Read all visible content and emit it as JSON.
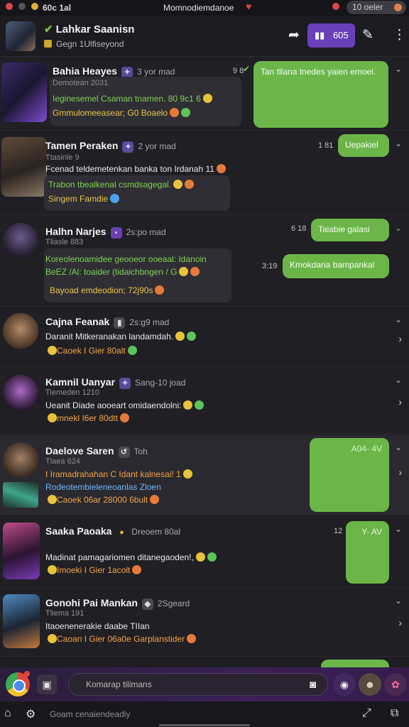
{
  "status": {
    "left_text": "60c 1al",
    "center_text": "Momnodiemdanoe",
    "pill_text": "10 oeler"
  },
  "header": {
    "title": "Lahkar Saanisn",
    "subtitle": "Gegn 1Ulfiseyond",
    "pill_label": "605",
    "colors": {
      "accent": "#6a40b8",
      "bubble_out": "#6bb549"
    }
  },
  "chats": [
    {
      "name": "Bahia Heayes",
      "meta": "3 yor mad",
      "sub": "Demotean 2031",
      "lines": [
        "Ieginesemel Csaman tnamen. 80 9c1 6",
        "Gmmulomeeasear;  G0 Boaelo"
      ],
      "time": "9 8",
      "out_bubble": "Tan tllana tnedes yaien emoei."
    },
    {
      "name": "Tamen Peraken",
      "meta": "2 yor mad",
      "sub": "Ttasinle 9",
      "lines": [
        "Fcenad teldemetenkan banka ton Irdanah  11",
        "Trabon tbealkenal  csmdsagegal.",
        "Singem  Famdie"
      ],
      "time": "1 81",
      "out_bubble": "Uepakiel"
    },
    {
      "name": "Halhn Narjes",
      "meta": "2s:po mad",
      "sub": "Tliasle 883",
      "lines": [
        "Koreolenoamidee geooeor ooeaal: Idanoin",
        "BeEZ /Al: toaider (tidaichbngen /  G",
        "Bayoad  emdeodion; 72j90s"
      ],
      "time": "6 18",
      "out_bubble": "Taiabie galasi",
      "time2": "3:19",
      "out_bubble2": "Kmokdaria bampankal"
    },
    {
      "name": "Cajna Feanak",
      "meta": "2s:g9 mad",
      "lines": [
        "Daranit Mitkeranakan landamdah.",
        "Caoek I Gier 80alt"
      ]
    },
    {
      "name": "Kamnil Uanyar",
      "meta": "Sang-10 joad",
      "sub": "Tiemeden 1210",
      "lines": [
        "Ueanit  Diade  aooeart omidaendolni:",
        "mnekl  I6er 80dtt"
      ]
    },
    {
      "name": "Daelove Saren",
      "meta": "Toh",
      "sub": "Tlaea 624",
      "lines": [
        "I Iramadrahahan C Idant kalnesai! 1",
        "Rodeotembieleneoanlas Zloen",
        "Caoek 06ar  28000  6bult"
      ],
      "out_bubble": "A04-   4V"
    },
    {
      "name": "Saaka Paoaka",
      "meta": "Dreoem 80al",
      "lines": [
        "Madinat pamagariomen ditanegaoden!,",
        "Imoeki I Gier 1acolt"
      ],
      "time": "12",
      "out_bubble": "Y-   AV"
    },
    {
      "name": "Gonohi Pai Mankan",
      "meta": "2Sgeard",
      "sub": "Tliema 191",
      "lines": [
        "Itaoenenerakie  daabe  TIIan",
        "Caoan  I Gier 06a0e     Garplanstider"
      ]
    }
  ],
  "composer": {
    "placeholder": "Komarap tilimans"
  },
  "bottom": {
    "search_placeholder": "Goam cenaiendeadiy"
  }
}
